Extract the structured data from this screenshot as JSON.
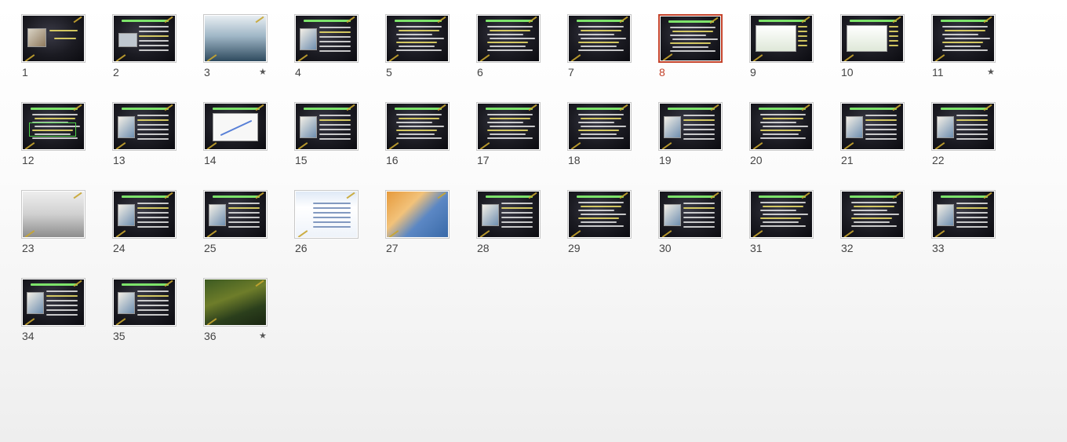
{
  "view": "slide-sorter",
  "selected_slide": "8",
  "accent_color": "#c4432b",
  "slides": [
    {
      "number": "1",
      "transition_star": false,
      "variant": "title"
    },
    {
      "number": "2",
      "transition_star": false,
      "variant": "text-image"
    },
    {
      "number": "3",
      "transition_star": true,
      "variant": "photo"
    },
    {
      "number": "4",
      "transition_star": false,
      "variant": "image-left"
    },
    {
      "number": "5",
      "transition_star": false,
      "variant": "text"
    },
    {
      "number": "6",
      "transition_star": false,
      "variant": "text"
    },
    {
      "number": "7",
      "transition_star": false,
      "variant": "text"
    },
    {
      "number": "8",
      "transition_star": false,
      "variant": "text"
    },
    {
      "number": "9",
      "transition_star": false,
      "variant": "screenshot"
    },
    {
      "number": "10",
      "transition_star": false,
      "variant": "screenshot"
    },
    {
      "number": "11",
      "transition_star": true,
      "variant": "text"
    },
    {
      "number": "12",
      "transition_star": false,
      "variant": "boxed"
    },
    {
      "number": "13",
      "transition_star": false,
      "variant": "image-left"
    },
    {
      "number": "14",
      "transition_star": false,
      "variant": "chart"
    },
    {
      "number": "15",
      "transition_star": false,
      "variant": "image-left"
    },
    {
      "number": "16",
      "transition_star": false,
      "variant": "text"
    },
    {
      "number": "17",
      "transition_star": false,
      "variant": "text"
    },
    {
      "number": "18",
      "transition_star": false,
      "variant": "text"
    },
    {
      "number": "19",
      "transition_star": false,
      "variant": "image-left"
    },
    {
      "number": "20",
      "transition_star": false,
      "variant": "text"
    },
    {
      "number": "21",
      "transition_star": false,
      "variant": "image-left"
    },
    {
      "number": "22",
      "transition_star": false,
      "variant": "image-left"
    },
    {
      "number": "23",
      "transition_star": false,
      "variant": "photo"
    },
    {
      "number": "24",
      "transition_star": false,
      "variant": "image-left"
    },
    {
      "number": "25",
      "transition_star": false,
      "variant": "image-left"
    },
    {
      "number": "26",
      "transition_star": false,
      "variant": "screenshot-full"
    },
    {
      "number": "27",
      "transition_star": false,
      "variant": "map"
    },
    {
      "number": "28",
      "transition_star": false,
      "variant": "image-left"
    },
    {
      "number": "29",
      "transition_star": false,
      "variant": "text"
    },
    {
      "number": "30",
      "transition_star": false,
      "variant": "image-left"
    },
    {
      "number": "31",
      "transition_star": false,
      "variant": "text"
    },
    {
      "number": "32",
      "transition_star": false,
      "variant": "text"
    },
    {
      "number": "33",
      "transition_star": false,
      "variant": "image-left"
    },
    {
      "number": "34",
      "transition_star": false,
      "variant": "image-left"
    },
    {
      "number": "35",
      "transition_star": false,
      "variant": "image-left"
    },
    {
      "number": "36",
      "transition_star": true,
      "variant": "photo"
    }
  ]
}
